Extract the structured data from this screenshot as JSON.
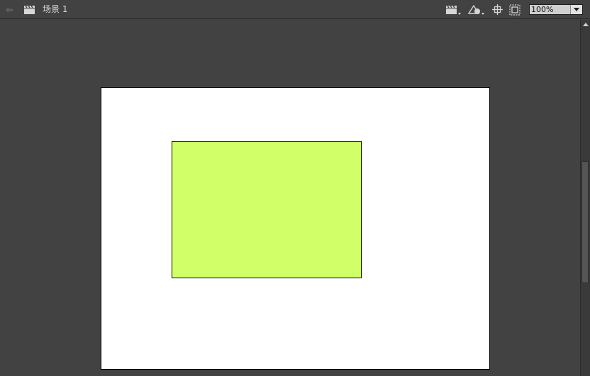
{
  "header": {
    "scene_label": "场景 1",
    "zoom": {
      "value": "100%"
    },
    "icons": {
      "back": "back-arrow-icon",
      "scene": "clapperboard-icon",
      "edit_scene": "clapperboard-dropdown-icon",
      "edit_symbols": "shapes-dropdown-icon",
      "center_stage": "crosshair-icon",
      "clip": "clip-stage-icon"
    }
  },
  "stage": {
    "background_color": "#ffffff",
    "shape": {
      "type": "rectangle",
      "fill_color": "#d0ff68",
      "stroke_color": "#000000"
    }
  },
  "workspace": {
    "background_color": "#424242"
  }
}
